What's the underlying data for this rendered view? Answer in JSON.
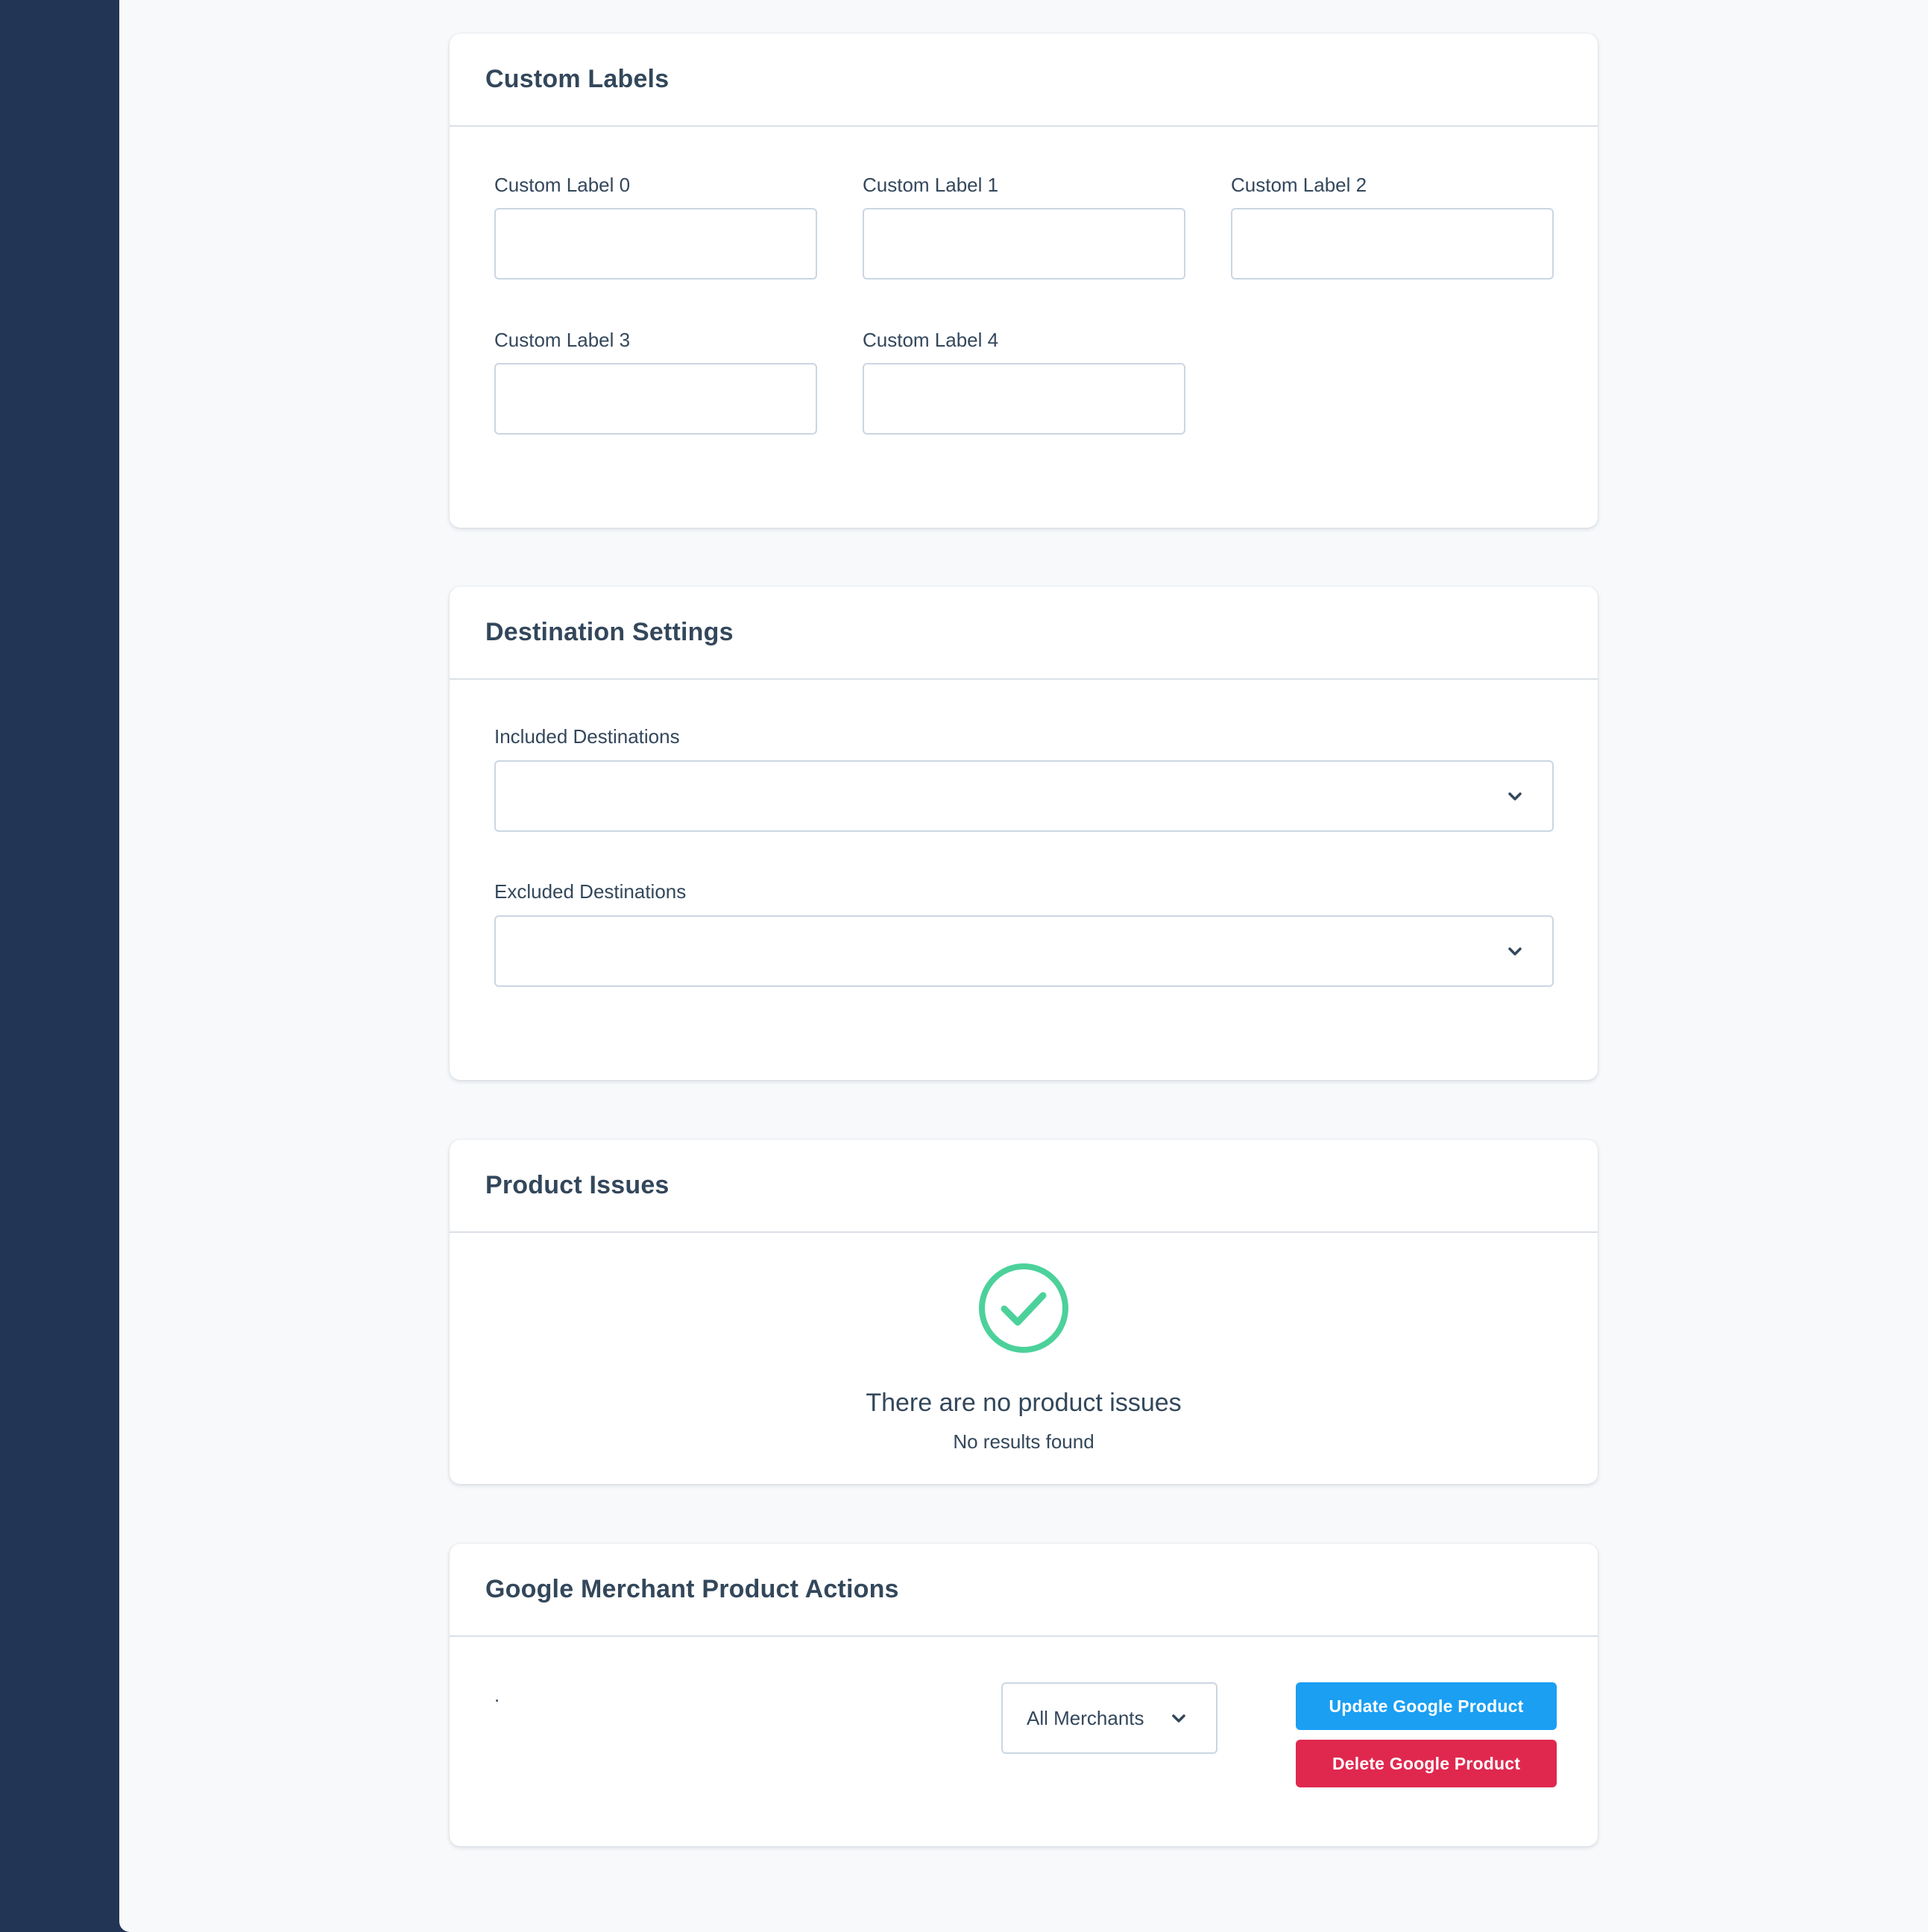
{
  "custom_labels": {
    "title": "Custom Labels",
    "fields": [
      {
        "label": "Custom Label 0",
        "value": ""
      },
      {
        "label": "Custom Label 1",
        "value": ""
      },
      {
        "label": "Custom Label 2",
        "value": ""
      },
      {
        "label": "Custom Label 3",
        "value": ""
      },
      {
        "label": "Custom Label 4",
        "value": ""
      }
    ]
  },
  "destination_settings": {
    "title": "Destination Settings",
    "included_label": "Included Destinations",
    "included_value": "",
    "excluded_label": "Excluded Destinations",
    "excluded_value": ""
  },
  "product_issues": {
    "title": "Product Issues",
    "empty_title": "There are no product issues",
    "empty_subtitle": "No results found"
  },
  "merchant_actions": {
    "title": "Google Merchant Product Actions",
    "note": ".",
    "merchant_select_value": "All Merchants",
    "update_button": "Update Google Product",
    "delete_button": "Delete Google Product"
  },
  "colors": {
    "sidebar": "#233554",
    "background": "#f7f9fb",
    "success": "#4cd19a",
    "primary": "#1a9ff2",
    "danger": "#e0284f"
  }
}
